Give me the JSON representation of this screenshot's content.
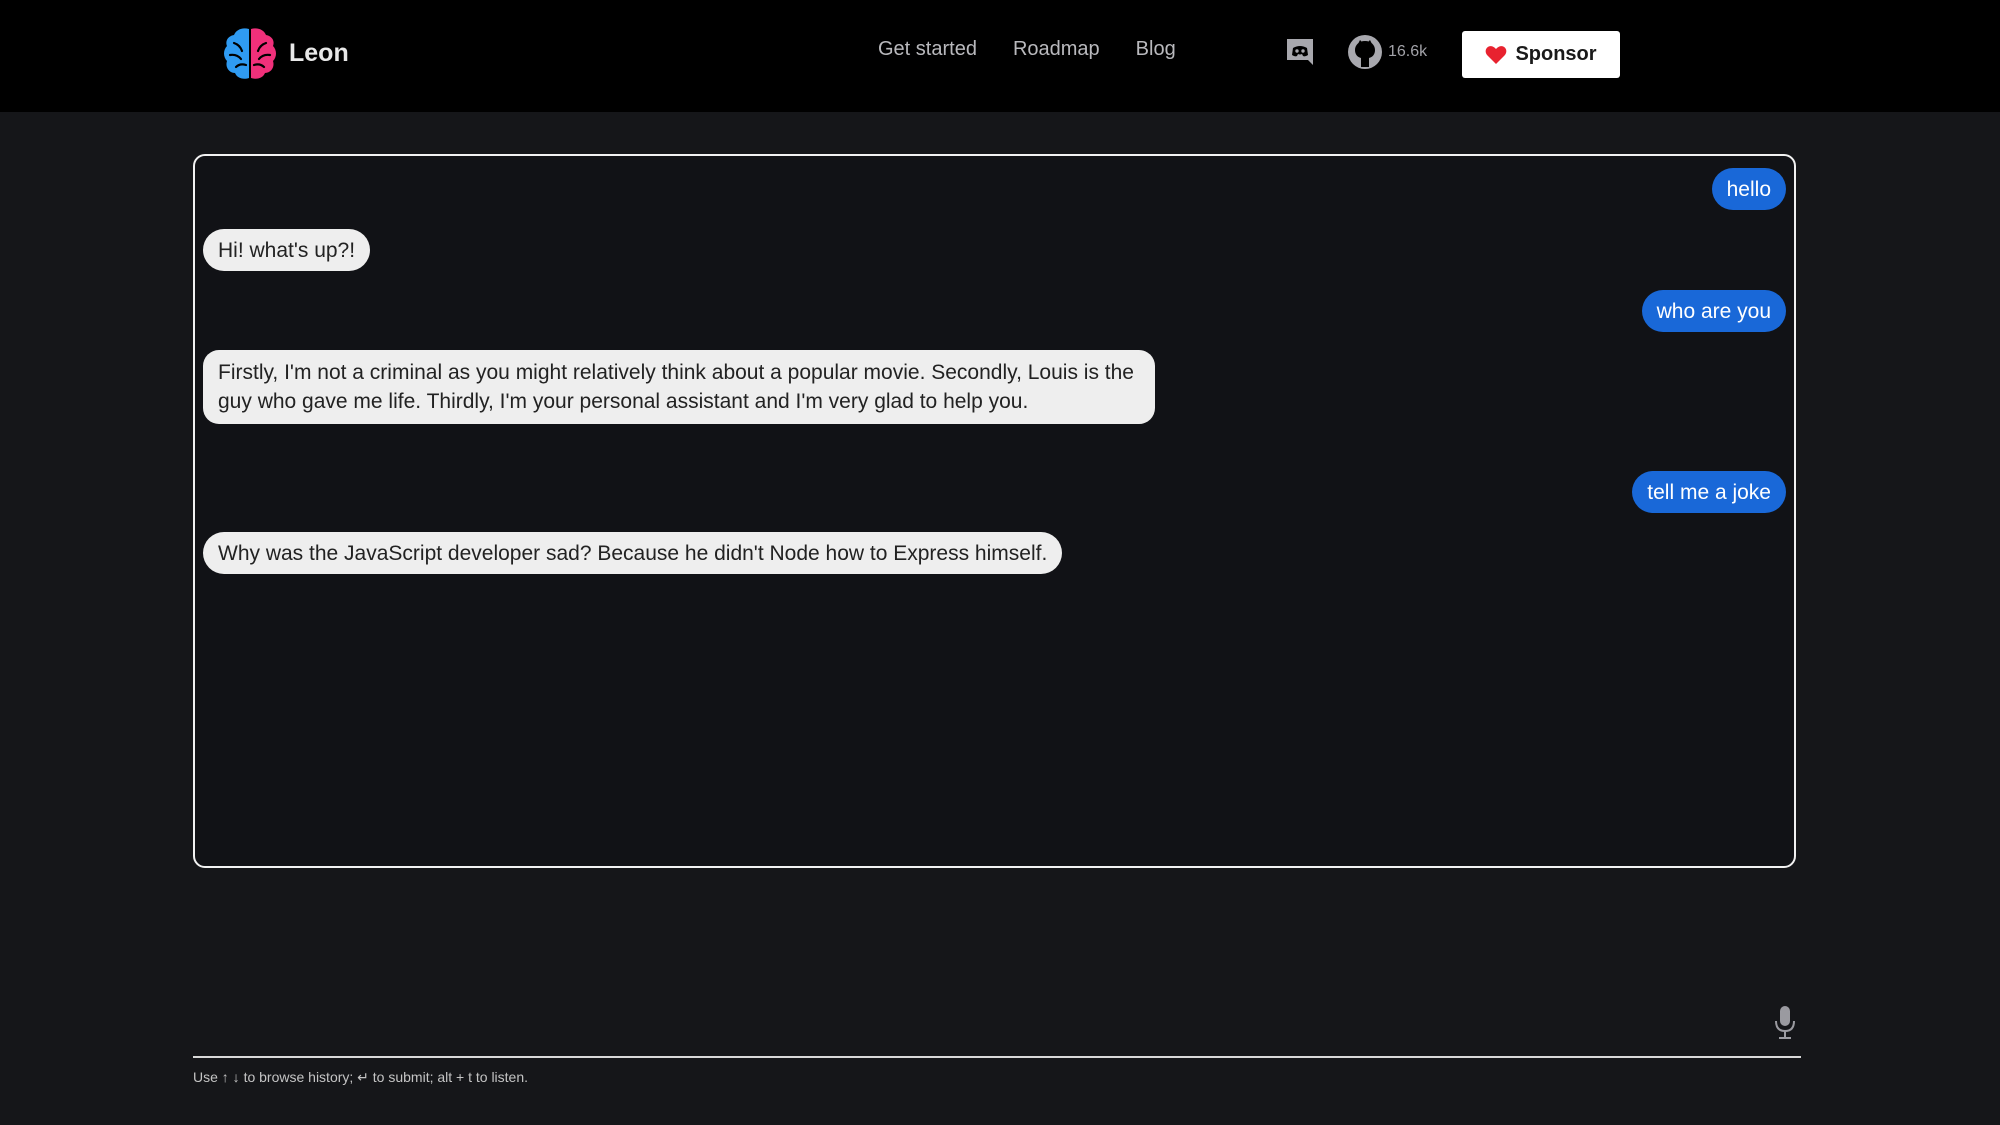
{
  "brand": {
    "name": "Leon"
  },
  "nav": [
    {
      "label": "Get started"
    },
    {
      "label": "Roadmap"
    },
    {
      "label": "Blog"
    }
  ],
  "social": {
    "discord_icon": "discord-icon",
    "github_icon": "github-icon",
    "github_stars": "16.6k"
  },
  "sponsor": {
    "label": "Sponsor",
    "icon": "heart-icon"
  },
  "colors": {
    "user_bubble": "#1968d8",
    "bot_bubble": "#eeeeee",
    "background": "#151619",
    "header": "#000000",
    "heart": "#e8222f"
  },
  "messages": [
    {
      "from": "user",
      "text": "hello"
    },
    {
      "from": "bot",
      "text": "Hi! what's up?!"
    },
    {
      "from": "user",
      "text": "who are you"
    },
    {
      "from": "bot",
      "text": "Firstly, I'm not a criminal as you might relatively think about a popular movie. Secondly, Louis is the guy who gave me life. Thirdly, I'm your personal assistant and I'm very glad to help you."
    },
    {
      "from": "user",
      "text": "tell me a joke"
    },
    {
      "from": "bot",
      "text": "Why was the JavaScript developer sad? Because he didn't Node how to Express himself."
    }
  ],
  "input": {
    "mic_icon": "microphone-icon"
  },
  "hint": "Use ↑ ↓ to browse history; ↵ to submit; alt + t to listen."
}
